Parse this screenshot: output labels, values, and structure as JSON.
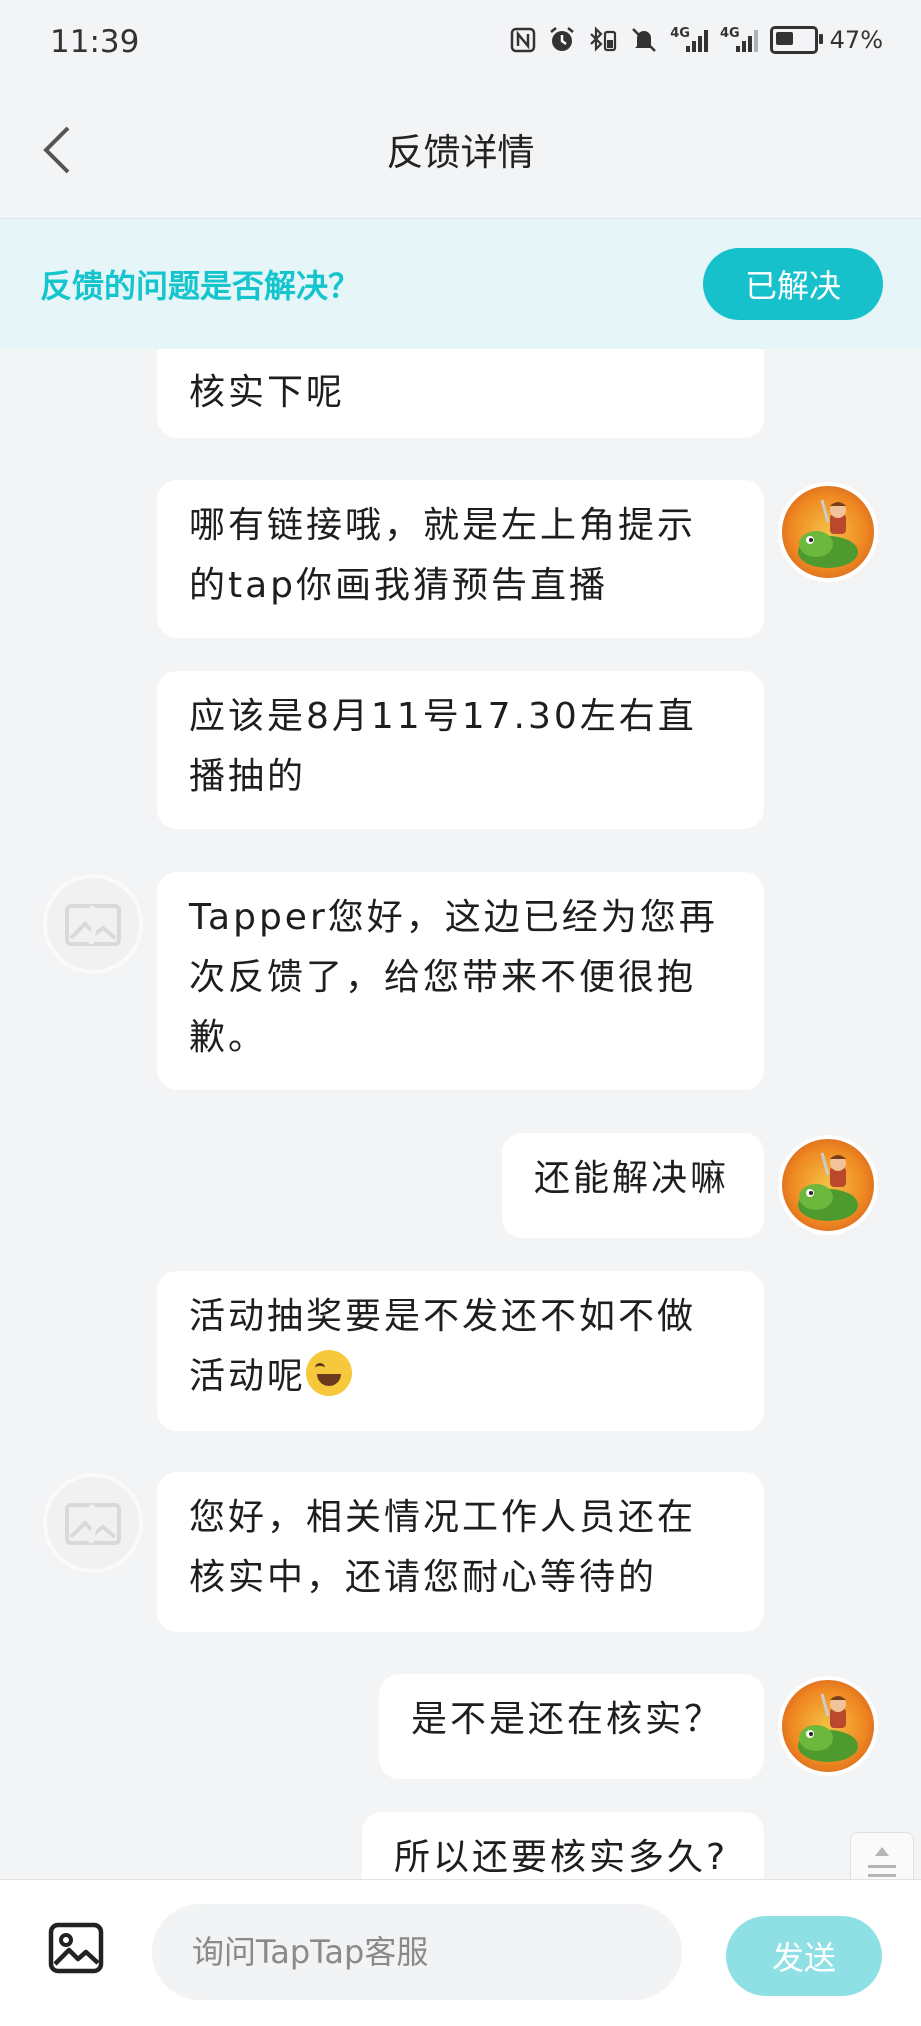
{
  "status_bar": {
    "time": "11:39",
    "battery_percent": "47%",
    "battery_level": 0.47,
    "network_tag": "4G",
    "icons": [
      "nfc-icon",
      "alarm-icon",
      "bluetooth-battery-icon",
      "mute-icon",
      "signal-icon",
      "signal-icon",
      "battery-icon"
    ]
  },
  "header": {
    "title": "反馈详情",
    "back_icon": "chevron-left-icon"
  },
  "resolve_banner": {
    "question": "反馈的问题是否解决？",
    "button_label": "已解决",
    "accent_color": "#16c1cc"
  },
  "messages": [
    {
      "sender": "user",
      "text": "核实下呢",
      "avatar": false
    },
    {
      "sender": "user",
      "text": "哪有链接哦，就是左上角提示的tap你画我猜预告直播",
      "avatar": true
    },
    {
      "sender": "user",
      "text": "应该是8月11号17.30左右直播抽的",
      "avatar": false
    },
    {
      "sender": "agent",
      "text": "Tapper您好，这边已经为您再次反馈了，给您带来不便很抱歉。",
      "avatar": true
    },
    {
      "sender": "user",
      "text": "还能解决嘛",
      "avatar": true
    },
    {
      "sender": "user",
      "text": "活动抽奖要是不发还不如不做活动呢",
      "emoji": "sweat-smile-emoji",
      "avatar": false
    },
    {
      "sender": "agent",
      "text": "您好，相关情况工作人员还在核实中，还请您耐心等待的",
      "avatar": true
    },
    {
      "sender": "user",
      "text": "是不是还在核实？",
      "avatar": true
    },
    {
      "sender": "user",
      "text": "所以还要核实多久?",
      "avatar": false
    }
  ],
  "input_bar": {
    "placeholder": "询问TapTap客服",
    "send_label": "发送",
    "image_icon": "image-icon"
  }
}
